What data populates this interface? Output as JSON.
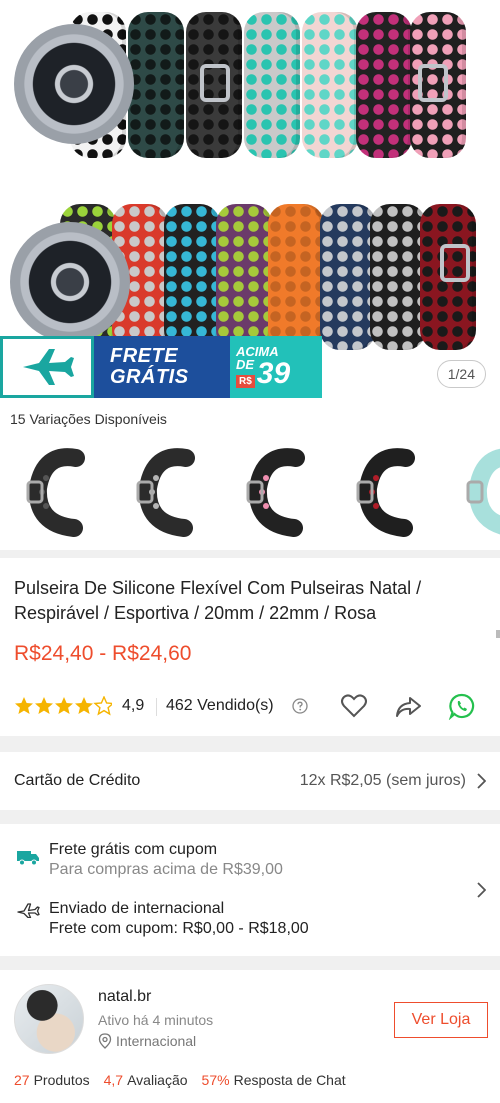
{
  "gallery": {
    "counter": "1/24",
    "banner": {
      "line1": "FRETE",
      "line2": "GRÁTIS",
      "label_small_1": "ACIMA",
      "label_small_2": "DE",
      "currency": "R$",
      "amount": "39"
    },
    "colors": {
      "brand_blue": "#1d4f9c",
      "teal": "#22c1b9",
      "shopee_orange": "#ee4d2d"
    }
  },
  "variations": {
    "title": "15 Variações Disponíveis"
  },
  "product": {
    "title": "Pulseira De Silicone Flexível Com Pulseiras Natal / Respirável / Esportiva / 20mm / 22mm / Rosa",
    "price": "R$24,40 - R$24,60",
    "rating": "4,9",
    "rating_fraction": 0.98,
    "sold": "462 Vendido(s)"
  },
  "payment": {
    "label": "Cartão de Crédito",
    "installments": "12x R$2,05 (sem juros)"
  },
  "shipping": {
    "free_title": "Frete grátis com cupom",
    "free_sub": "Para compras acima de R$39,00",
    "intl_title": "Enviado de internacional",
    "intl_sub": "Frete com cupom: R$0,00 - R$18,00"
  },
  "shop": {
    "name": "natal.br",
    "active": "Ativo há 4 minutos",
    "location": "Internacional",
    "button": "Ver Loja",
    "stats": [
      {
        "value": "27",
        "label": "Produtos"
      },
      {
        "value": "4,7",
        "label": "Avaliação"
      },
      {
        "value": "57%",
        "label": "Resposta de Chat"
      }
    ]
  }
}
